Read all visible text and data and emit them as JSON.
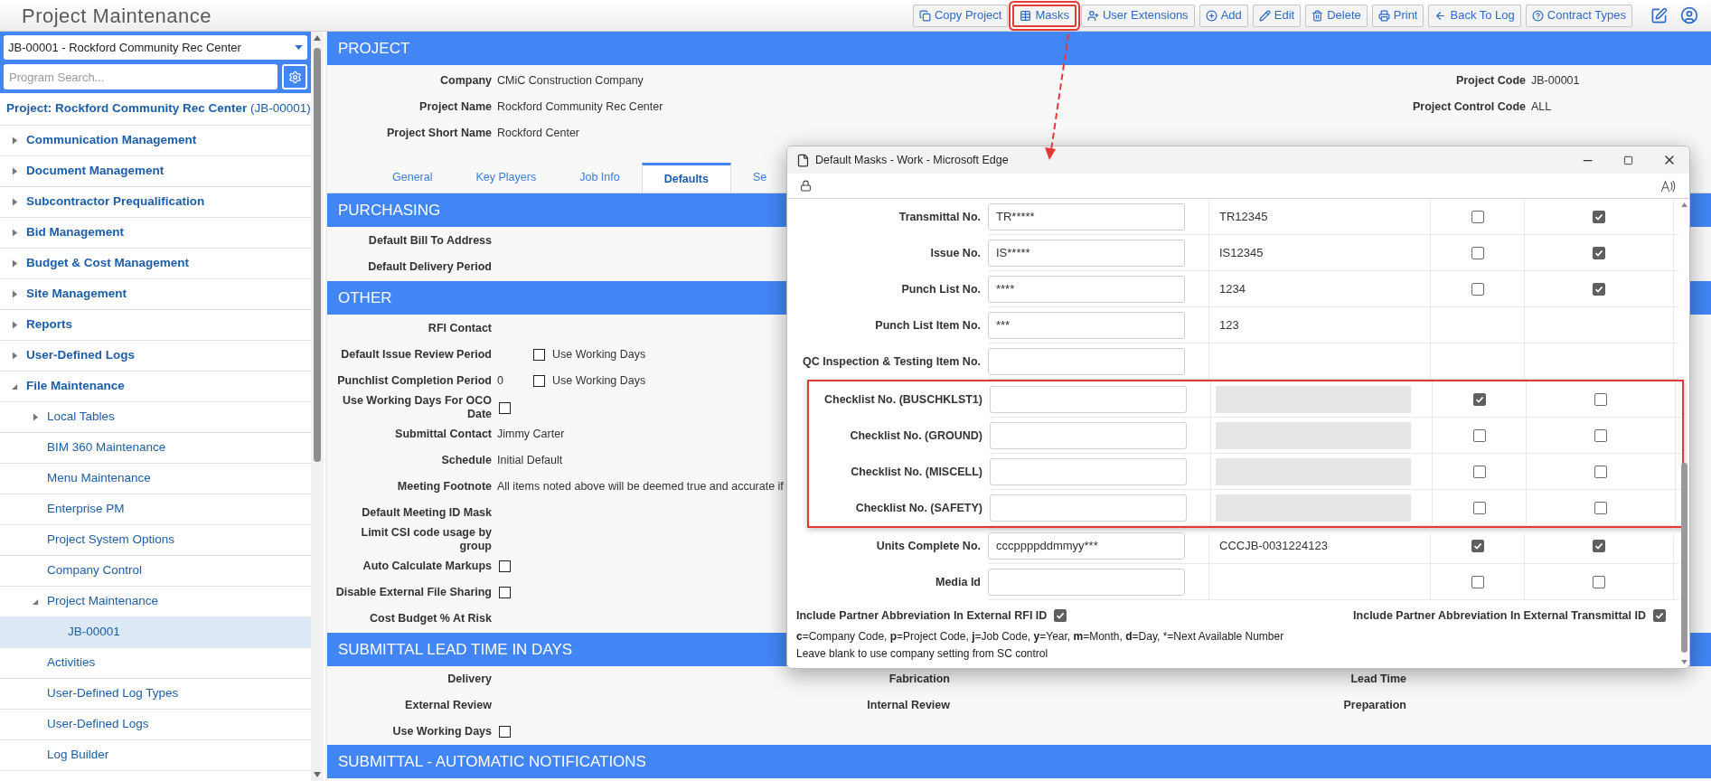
{
  "header": {
    "title": "Project Maintenance",
    "toolbar": [
      {
        "label": "Copy Project",
        "highlighted": false
      },
      {
        "label": "Masks",
        "highlighted": true
      },
      {
        "label": "User Extensions",
        "highlighted": false
      },
      {
        "label": "Add",
        "highlighted": false
      },
      {
        "label": "Edit",
        "highlighted": false
      },
      {
        "label": "Delete",
        "highlighted": false
      },
      {
        "label": "Print",
        "highlighted": false
      },
      {
        "label": "Back To Log",
        "highlighted": false
      },
      {
        "label": "Contract Types",
        "highlighted": false
      }
    ]
  },
  "sidebar": {
    "project_select": {
      "value": "JB-00001 - Rockford Community Rec Center"
    },
    "search": {
      "placeholder": "Program Search..."
    },
    "project_heading": "**Project: Rockford Community Rec Center** (JB-00001)",
    "items": [
      {
        "label": "Communication Management",
        "expanded": false,
        "selected": false
      },
      {
        "label": "Document Management",
        "expanded": false,
        "selected": false
      },
      {
        "label": "Subcontractor Prequalification",
        "expanded": false,
        "selected": false
      },
      {
        "label": "Bid Management",
        "expanded": false,
        "selected": false
      },
      {
        "label": "Budget & Cost Management",
        "expanded": false,
        "selected": false
      },
      {
        "label": "Site Management",
        "expanded": false,
        "selected": false
      },
      {
        "label": "Reports",
        "expanded": false,
        "selected": false
      },
      {
        "label": "User-Defined Logs",
        "expanded": false,
        "selected": false
      },
      {
        "label": "File Maintenance",
        "expanded": true,
        "selected": false,
        "children": [
          {
            "label": "Local Tables",
            "expanded": false,
            "selected": false
          },
          {
            "label": "BIM 360 Maintenance",
            "selected": false
          },
          {
            "label": "Menu Maintenance",
            "selected": false
          },
          {
            "label": "Enterprise PM",
            "selected": false
          },
          {
            "label": "Project System Options",
            "selected": false
          },
          {
            "label": "Company Control",
            "selected": false
          },
          {
            "label": "Project Maintenance",
            "expanded": true,
            "selected": false,
            "children": [
              {
                "label": "JB-00001",
                "selected": true
              }
            ]
          },
          {
            "label": "Activities",
            "selected": false
          },
          {
            "label": "User-Defined Log Types",
            "selected": false
          },
          {
            "label": "User-Defined Logs",
            "selected": false
          },
          {
            "label": "Log Builder",
            "selected": false
          }
        ]
      }
    ]
  },
  "project": {
    "title": "PROJECT",
    "fields_left": [
      {
        "label": "Company",
        "value": "CMiC Construction Company"
      },
      {
        "label": "Project Name",
        "value": "Rockford Community Rec Center"
      },
      {
        "label": "Project Short Name",
        "value": "Rockford Center"
      }
    ],
    "fields_right": [
      {
        "label": "Project Code",
        "value": "JB-00001"
      },
      {
        "label": "Project Control Code",
        "value": "ALL"
      }
    ]
  },
  "tabs": [
    {
      "label": "General",
      "selected": false
    },
    {
      "label": "Key Players",
      "selected": false
    },
    {
      "label": "Job Info",
      "selected": false
    },
    {
      "label": "Defaults",
      "selected": true
    },
    {
      "label": "Se",
      "selected": false
    }
  ],
  "sections": [
    {
      "title": "PURCHASING",
      "rows": [
        {
          "kind": "text",
          "label": "Default Bill To Address"
        },
        {
          "kind": "text",
          "label": "Default Delivery Period"
        }
      ]
    },
    {
      "title": "OTHER",
      "rows": [
        {
          "kind": "text",
          "label": "RFI Contact"
        },
        {
          "kind": "period",
          "label": "Default Issue Review Period",
          "checked": false,
          "option": "Use Working Days"
        },
        {
          "kind": "period",
          "label": "Punchlist Completion Period",
          "value": "0",
          "checked": false,
          "option": "Use Working Days"
        },
        {
          "kind": "checkbox",
          "label": "Use Working Days For OCO Date",
          "checked": false
        },
        {
          "kind": "text",
          "label": "Submittal Contact",
          "value": "Jimmy Carter"
        },
        {
          "kind": "text",
          "label": "Schedule",
          "value": "Initial Default"
        },
        {
          "kind": "text",
          "label": "Meeting Footnote",
          "value": "All items noted above will be deemed true and accurate if"
        },
        {
          "kind": "text",
          "label": "Default Meeting ID Mask"
        },
        {
          "kind": "text",
          "label": "Limit CSI code usage by group"
        },
        {
          "kind": "checkbox",
          "label": "Auto Calculate Markups",
          "checked": false
        },
        {
          "kind": "checkbox",
          "label": "Disable External File Sharing",
          "checked": false
        },
        {
          "kind": "text",
          "label": "Cost Budget % At Risk"
        }
      ]
    },
    {
      "title": "SUBMITTAL LEAD TIME IN DAYS",
      "grid": [
        [
          {
            "kind": "text",
            "label": "Delivery"
          },
          {
            "kind": "text",
            "label": "Fabrication"
          },
          {
            "kind": "text",
            "label": "Lead Time"
          }
        ],
        [
          {
            "kind": "text",
            "label": "External Review"
          },
          {
            "kind": "text",
            "label": "Internal Review"
          },
          {
            "kind": "text",
            "label": "Preparation"
          }
        ],
        [
          {
            "kind": "checkbox",
            "label": "Use Working Days",
            "checked": false
          }
        ]
      ]
    },
    {
      "title": "SUBMITTAL - AUTOMATIC NOTIFICATIONS"
    }
  ],
  "modal": {
    "title": "Default Masks - Work - Microsoft Edge",
    "rows": [
      {
        "label": "Transmittal No.",
        "mask": "TR*****",
        "sample": "TR12345",
        "disabled": false,
        "highlighted": false,
        "column_4": {
          "checked": false
        },
        "column_5": {
          "checked": true
        }
      },
      {
        "label": "Issue No.",
        "mask": "IS*****",
        "sample": "IS12345",
        "disabled": false,
        "highlighted": false,
        "column_4": {
          "checked": false
        },
        "column_5": {
          "checked": true
        }
      },
      {
        "label": "Punch List No.",
        "mask": "****",
        "sample": "1234",
        "disabled": false,
        "highlighted": false,
        "column_4": {
          "checked": false
        },
        "column_5": {
          "checked": true
        }
      },
      {
        "label": "Punch List Item No.",
        "mask": "***",
        "sample": "123",
        "disabled": false,
        "highlighted": false
      },
      {
        "label": "QC Inspection & Testing Item No.",
        "disabled": false,
        "highlighted": false
      },
      {
        "label": "Checklist No. (BUSCHKLST1)",
        "disabled": true,
        "highlighted": true,
        "column_4": {
          "checked": true
        },
        "column_5": {
          "checked": false
        }
      },
      {
        "label": "Checklist No. (GROUND)",
        "disabled": true,
        "highlighted": true,
        "column_4": {
          "checked": false
        },
        "column_5": {
          "checked": false
        }
      },
      {
        "label": "Checklist No. (MISCELL)",
        "disabled": true,
        "highlighted": true,
        "column_4": {
          "checked": false
        },
        "column_5": {
          "checked": false
        }
      },
      {
        "label": "Checklist No. (SAFETY)",
        "disabled": true,
        "highlighted": true,
        "column_4": {
          "checked": false
        },
        "column_5": {
          "checked": false
        }
      },
      {
        "label": "Units Complete No.",
        "mask": "cccppppddmmyy***",
        "sample": "CCCJB-0031224123",
        "disabled": false,
        "highlighted": false,
        "column_4": {
          "checked": true
        },
        "column_5": {
          "checked": true
        }
      },
      {
        "label": "Media Id",
        "disabled": false,
        "highlighted": false,
        "column_4": {
          "checked": false
        },
        "column_5": {
          "checked": false
        }
      }
    ],
    "options": [
      {
        "label": "Include Partner Abbreviation In External RFI ID",
        "checked": true
      },
      {
        "label": "Include Partner Abbreviation In External Transmittal ID",
        "checked": true
      }
    ],
    "legend": "**c**=Company Code, **p**=Project Code, **j**=Job Code, **y**=Year, **m**=Month, **d**=Day, *=Next Available Number",
    "note": "Leave blank to use company setting from SC control"
  }
}
